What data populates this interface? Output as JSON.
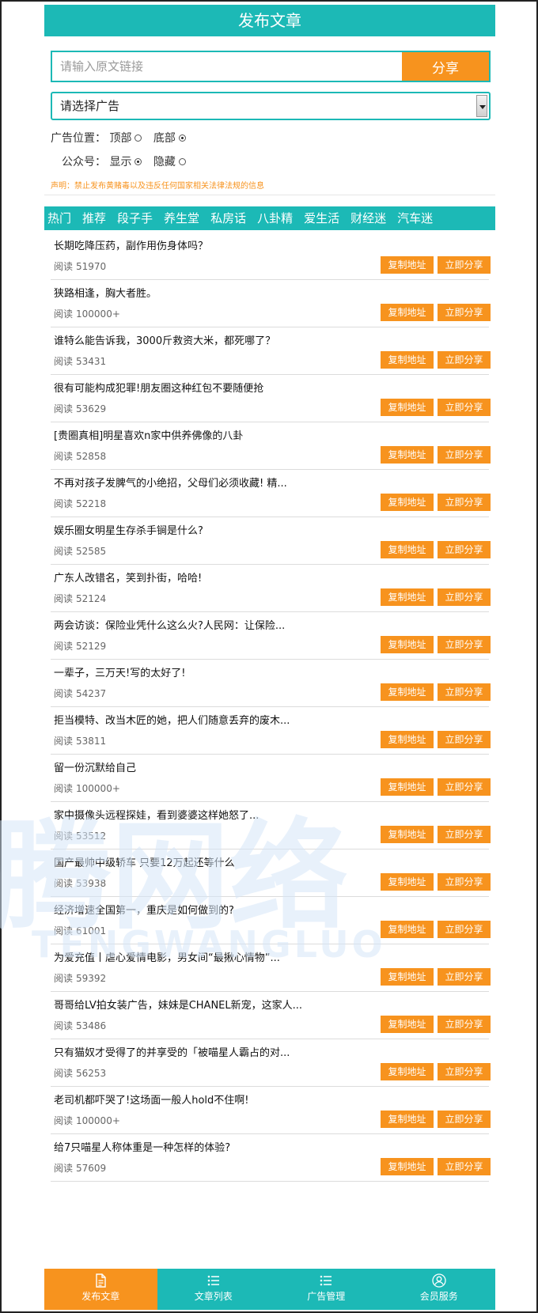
{
  "header": {
    "title": "发布文章"
  },
  "share": {
    "placeholder": "请输入原文链接",
    "button": "分享"
  },
  "ad_select": {
    "selected": "请选择广告"
  },
  "ad_position": {
    "label": "广告位置：",
    "options": [
      "顶部",
      "底部"
    ],
    "selected": "底部"
  },
  "account": {
    "label": "公众号：",
    "options": [
      "显示",
      "隐藏"
    ],
    "selected": "显示"
  },
  "notice": "声明：禁止发布黄赌毒以及违反任何国家相关法律法规的信息",
  "tabs": [
    "热门",
    "推荐",
    "段子手",
    "养生堂",
    "私房话",
    "八卦精",
    "爱生活",
    "财经迷",
    "汽车迷"
  ],
  "read_label": "阅读",
  "copy_label": "复制地址",
  "share_label": "立即分享",
  "articles": [
    {
      "title": "长期吃降压药，副作用伤身体吗？",
      "reads": "51970"
    },
    {
      "title": "狭路相逢，胸大者胜。",
      "reads": "100000+"
    },
    {
      "title": "谁特么能告诉我，3000斤救资大米，都死哪了？",
      "reads": "53431"
    },
    {
      "title": "很有可能构成犯罪!朋友圈这种红包不要随便抢",
      "reads": "53629"
    },
    {
      "title": "[贵圈真相]明星喜欢n家中供养佛像的八卦",
      "reads": "52858"
    },
    {
      "title": "不再对孩子发脾气的小绝招，父母们必须收藏! 精...",
      "reads": "52218"
    },
    {
      "title": "娱乐圈女明星生存杀手锏是什么?",
      "reads": "52585"
    },
    {
      "title": "广东人改错名，笑到扑街，哈哈!",
      "reads": "52124"
    },
    {
      "title": "两会访谈：保险业凭什么这么火?人民网：让保险...",
      "reads": "52129"
    },
    {
      "title": "一辈子，三万天!写的太好了!",
      "reads": "54237"
    },
    {
      "title": "拒当模特、改当木匠的她，把人们随意丢弃的废木...",
      "reads": "53811"
    },
    {
      "title": "留一份沉默给自己",
      "reads": "100000+"
    },
    {
      "title": "家中摄像头远程探娃，看到婆婆这样她怒了...",
      "reads": "53512"
    },
    {
      "title": "国产最帅中级轿车 只要12万起还等什么",
      "reads": "53938"
    },
    {
      "title": "经济增速全国第一，重庆是如何做到的?",
      "reads": "61001"
    },
    {
      "title": "为爱充值丨虐心爱情电影，男女间“最揪心情物”...",
      "reads": "59392"
    },
    {
      "title": "哥哥给LV拍女装广告，妹妹是CHANEL新宠，这家人...",
      "reads": "53486"
    },
    {
      "title": "只有猫奴才受得了的并享受的「被喵星人霸占的对...",
      "reads": "56253"
    },
    {
      "title": "老司机都吓哭了!这场面一般人hold不住啊!",
      "reads": "100000+"
    },
    {
      "title": "给7只喵星人称体重是一种怎样的体验?",
      "reads": "57609"
    }
  ],
  "watermark": {
    "text": "腾网络",
    "sub": "TENGWANGLUO"
  },
  "bottom_nav": [
    {
      "label": "发布文章",
      "icon": "document-icon",
      "active": true
    },
    {
      "label": "文章列表",
      "icon": "list-icon",
      "active": false
    },
    {
      "label": "广告管理",
      "icon": "list-icon",
      "active": false
    },
    {
      "label": "会员服务",
      "icon": "user-icon",
      "active": false
    }
  ],
  "colors": {
    "teal": "#1cb9b6",
    "orange": "#f7931e"
  }
}
